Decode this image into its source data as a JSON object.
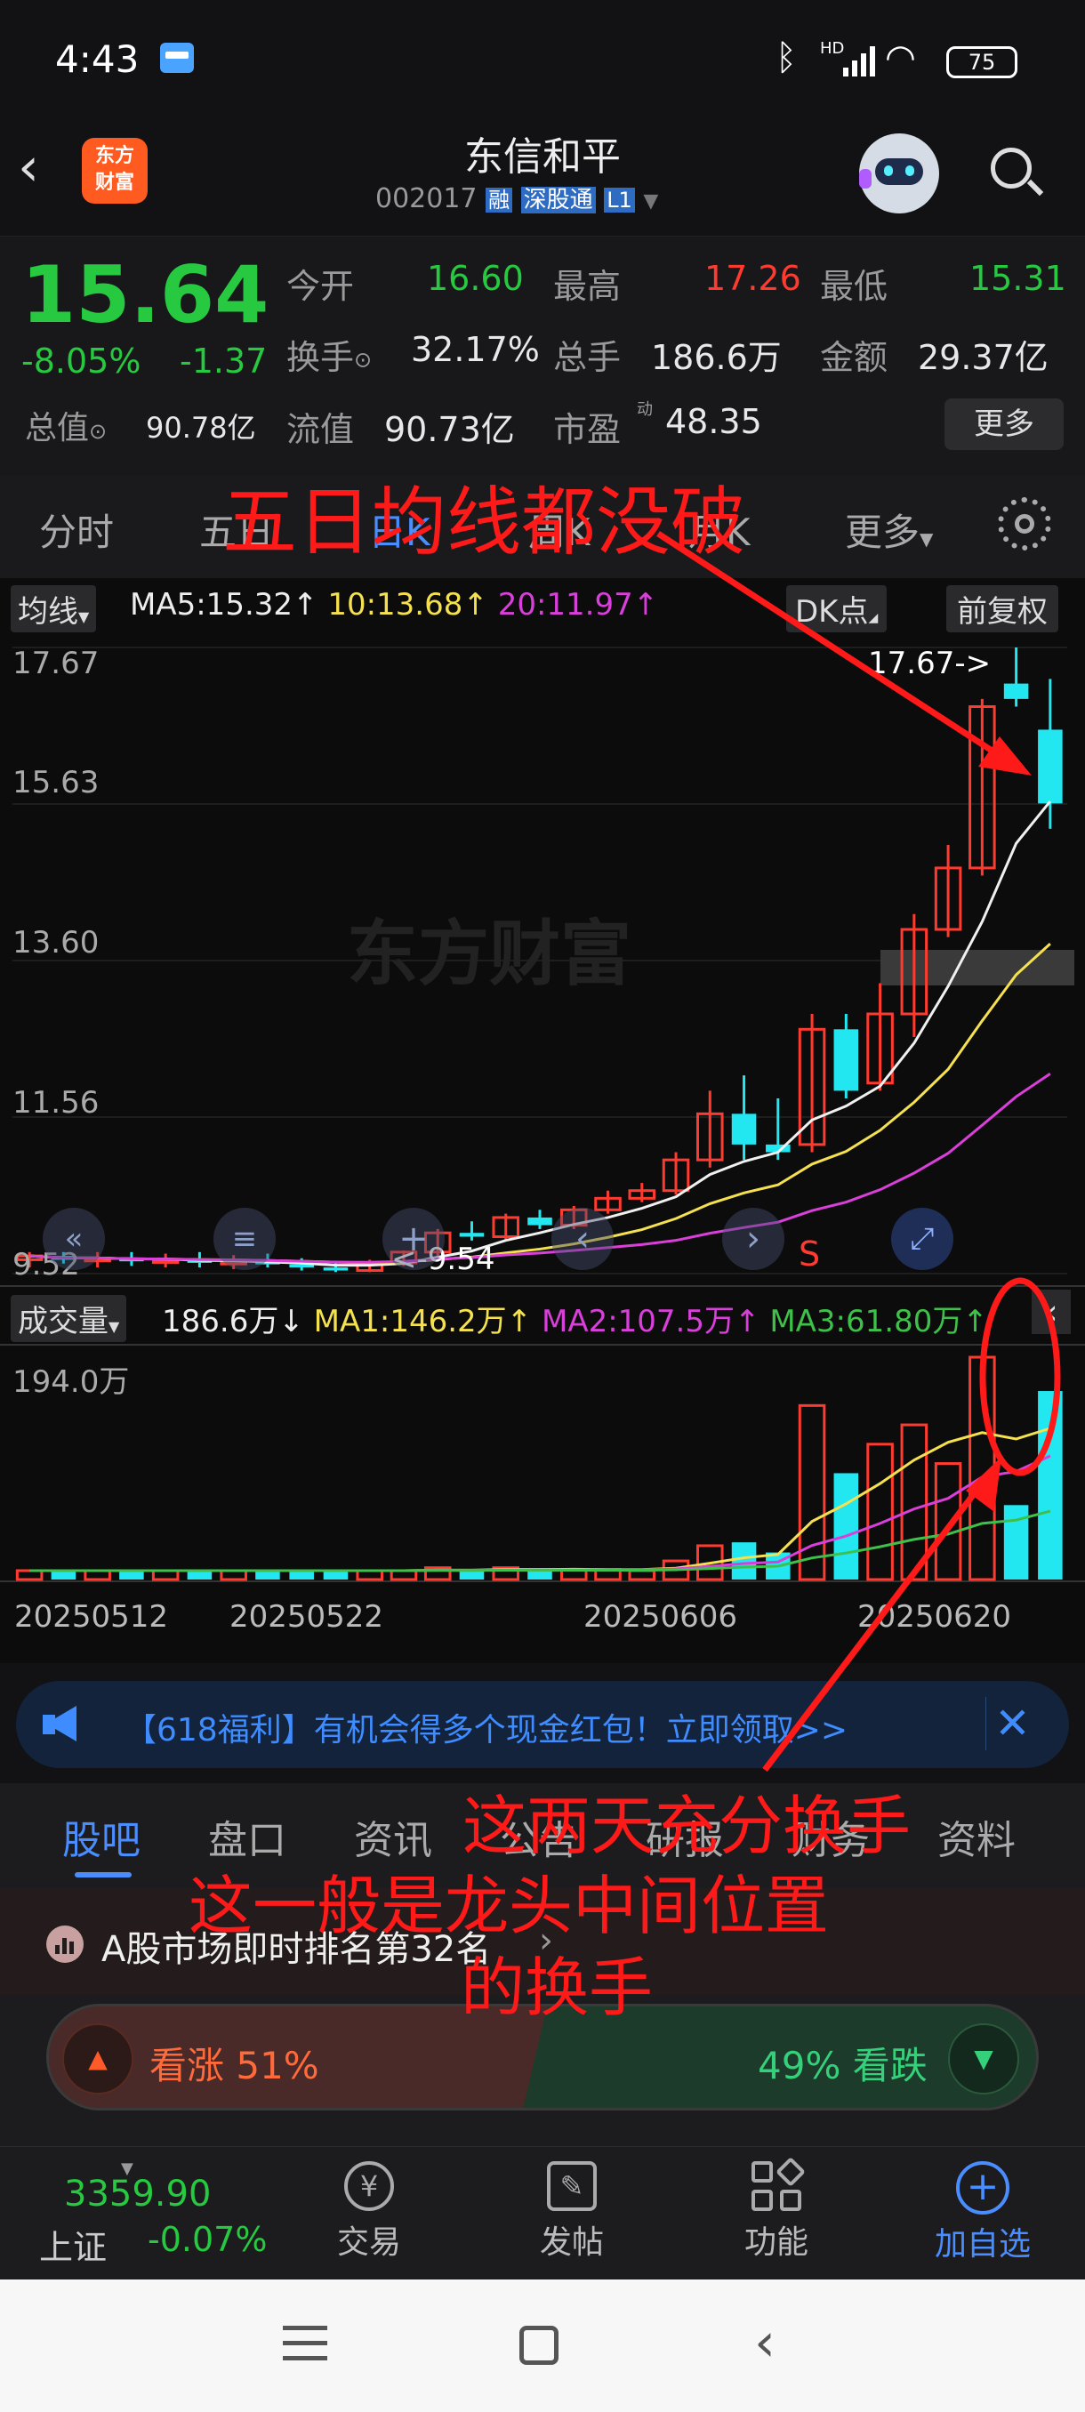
{
  "status": {
    "time": "4:43",
    "battery": "75",
    "net": "HD"
  },
  "header": {
    "name": "东信和平",
    "code": "002017",
    "tag_rong": "融",
    "tag_sgt": "深股通",
    "tag_l1": "L1",
    "logo_top": "东方",
    "logo_bottom": "财富"
  },
  "quote": {
    "price": "15.64",
    "change_pct": "-8.05%",
    "change": "-1.37",
    "items": [
      {
        "label": "今开",
        "value": "16.60",
        "color": "green"
      },
      {
        "label": "最高",
        "value": "17.26",
        "color": "red"
      },
      {
        "label": "最低",
        "value": "15.31",
        "color": "green"
      },
      {
        "label": "换手",
        "value": "32.17%",
        "color": "white"
      },
      {
        "label": "总手",
        "value": "186.6万",
        "color": "white"
      },
      {
        "label": "金额",
        "value": "29.37亿",
        "color": "white"
      }
    ],
    "zongzhi_label": "总值",
    "zongzhi": "90.78亿",
    "liuzhi_label": "流值",
    "liuzhi": "90.73亿",
    "pe_label": "市盈",
    "pe_sup": "动",
    "pe": "48.35",
    "more": "更多"
  },
  "tabs": [
    "分时",
    "五日",
    "日K",
    "周K",
    "月K",
    "更多"
  ],
  "chart": {
    "ma_label": "均线",
    "ma5": "MA5:15.32",
    "ma10": "10:13.68",
    "ma20": "20:11.97",
    "dk": "DK点",
    "fq": "前复权",
    "y_labels": [
      "17.67",
      "15.63",
      "13.60",
      "11.56",
      "9.52"
    ],
    "high_mark": "17.67->",
    "low_mark": "<-9.54",
    "watermark": "东方财富",
    "s_mark": "S",
    "vol_label": "成交量",
    "vol": "186.6万",
    "vol_ma1": "MA1:146.2万",
    "vol_ma2": "MA2:107.5万",
    "vol_ma3": "MA3:61.80万",
    "vol_max": "194.0万",
    "dates": [
      "20250512",
      "20250522",
      "20250606",
      "20250620"
    ]
  },
  "chart_data": {
    "type": "candlestick",
    "ylim": [
      9.52,
      17.67
    ],
    "ohlc": [
      [
        9.7,
        9.8,
        9.6,
        9.75
      ],
      [
        9.75,
        9.8,
        9.65,
        9.7
      ],
      [
        9.7,
        9.8,
        9.6,
        9.72
      ],
      [
        9.72,
        9.8,
        9.62,
        9.68
      ],
      [
        9.68,
        9.78,
        9.6,
        9.7
      ],
      [
        9.7,
        9.8,
        9.6,
        9.66
      ],
      [
        9.66,
        9.76,
        9.58,
        9.68
      ],
      [
        9.68,
        9.78,
        9.6,
        9.64
      ],
      [
        9.64,
        9.72,
        9.56,
        9.6
      ],
      [
        9.6,
        9.66,
        9.54,
        9.56
      ],
      [
        9.56,
        9.7,
        9.54,
        9.66
      ],
      [
        9.66,
        9.82,
        9.62,
        9.8
      ],
      [
        9.8,
        10.1,
        9.75,
        10.05
      ],
      [
        10.05,
        10.2,
        9.95,
        10.0
      ],
      [
        10.0,
        10.3,
        9.95,
        10.25
      ],
      [
        10.25,
        10.35,
        10.1,
        10.15
      ],
      [
        10.15,
        10.4,
        10.1,
        10.35
      ],
      [
        10.35,
        10.6,
        10.3,
        10.5
      ],
      [
        10.5,
        10.7,
        10.45,
        10.6
      ],
      [
        10.6,
        11.1,
        10.55,
        11.0
      ],
      [
        11.0,
        11.9,
        10.9,
        11.6
      ],
      [
        11.6,
        12.1,
        11.0,
        11.2
      ],
      [
        11.2,
        11.8,
        11.0,
        11.1
      ],
      [
        11.2,
        12.9,
        11.1,
        12.7
      ],
      [
        12.7,
        12.9,
        11.8,
        11.9
      ],
      [
        12.0,
        13.3,
        11.9,
        12.9
      ],
      [
        12.9,
        14.2,
        12.6,
        14.0
      ],
      [
        14.0,
        15.1,
        13.9,
        14.8
      ],
      [
        14.8,
        17.0,
        14.7,
        16.9
      ],
      [
        17.2,
        17.67,
        16.9,
        17.0
      ],
      [
        16.6,
        17.26,
        15.31,
        15.64
      ]
    ],
    "volume_max": "194.0万",
    "title": ""
  },
  "banner": {
    "text": "【618福利】有机会得多个现金红包！立即领取>>"
  },
  "subtabs": [
    "股吧",
    "盘口",
    "资讯",
    "公告",
    "研报",
    "财务",
    "资料"
  ],
  "rank": {
    "text": "A股市场即时排名第32名"
  },
  "vote": {
    "up": "看涨 51%",
    "down": "49% 看跌",
    "up_pct": 51
  },
  "bottomnav": {
    "index_value": "3359.90",
    "index_name": "上证",
    "index_change": "-0.07%",
    "items": [
      "交易",
      "发帖",
      "功能",
      "加自选"
    ]
  },
  "annotations": {
    "a1": "五日均线都没破",
    "a2": "这两天充分换手",
    "a3": "这一般是龙头中间位置",
    "a4": "的换手"
  }
}
